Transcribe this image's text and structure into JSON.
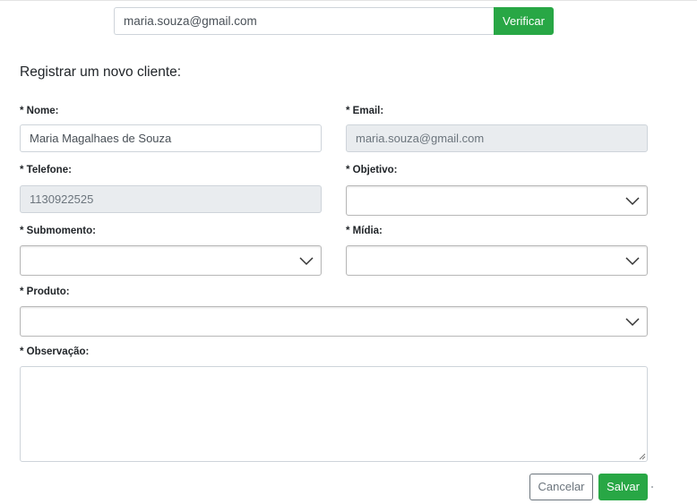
{
  "verify": {
    "email_value": "maria.souza@gmail.com",
    "button_label": "Verificar"
  },
  "form": {
    "title": "Registrar um novo cliente:",
    "nome": {
      "label": "* Nome:",
      "value": "Maria Magalhaes de Souza"
    },
    "email": {
      "label": "* Email:",
      "value": "maria.souza@gmail.com"
    },
    "telefone": {
      "label": "* Telefone:",
      "value": "1130922525"
    },
    "objetivo": {
      "label": "* Objetivo:",
      "value": ""
    },
    "submomento": {
      "label": "* Submomento:",
      "value": ""
    },
    "midia": {
      "label": "* Mídia:",
      "value": ""
    },
    "produto": {
      "label": "* Produto:",
      "value": ""
    },
    "observacao": {
      "label": "* Observação:",
      "value": ""
    }
  },
  "actions": {
    "cancel_label": "Cancelar",
    "save_label": "Salvar"
  },
  "colors": {
    "accent_green": "#28a745",
    "readonly_bg": "#e9ecef",
    "border": "#ced4da"
  }
}
